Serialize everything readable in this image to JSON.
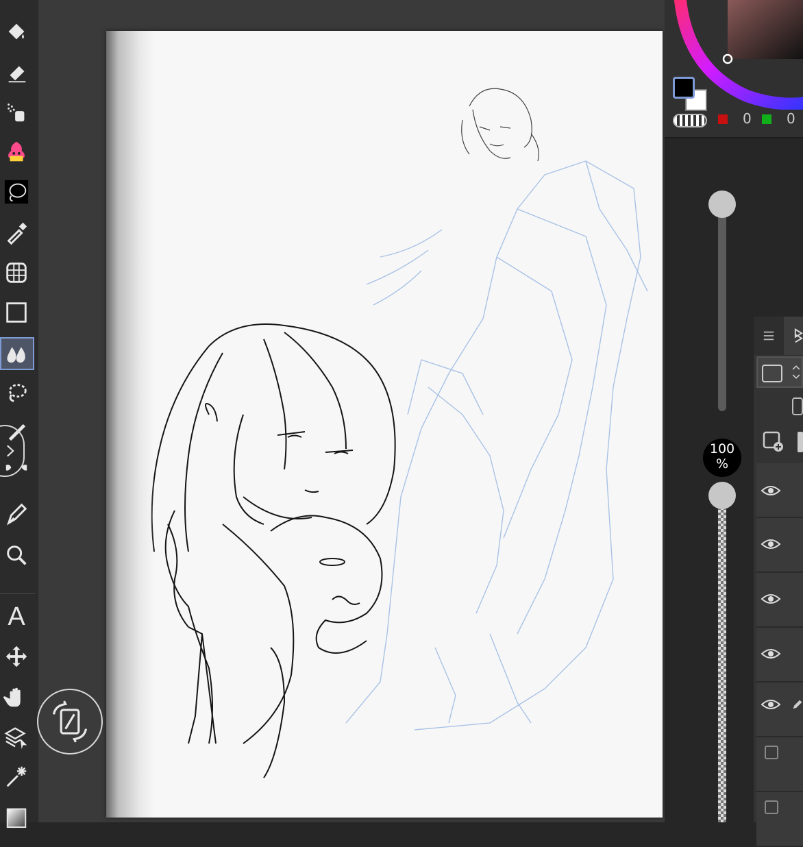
{
  "toolbar": {
    "tools": [
      "fill-icon",
      "eraser-icon",
      "airbrush-icon",
      "decoration-icon",
      "lasso-fill-icon",
      "eyedropper-icon",
      "perspective-icon",
      "rectangle-select-icon",
      "blend-icon",
      "lasso-select-icon",
      "pen-icon",
      "brush-icon",
      "pen-nib-icon",
      "zoom-icon",
      "text-icon",
      "move-icon",
      "hand-icon",
      "layer-move-icon",
      "magic-wand-icon",
      "gradient-icon"
    ],
    "active_tool": "blend-icon",
    "text_tool_label": "A"
  },
  "color": {
    "main": "#000000",
    "sub": "#ffffff",
    "r_value": "0",
    "g_value": "0",
    "accent": "#7f9bd6"
  },
  "brush": {
    "opacity_label": "100\n%",
    "opacity_text": "100",
    "opacity_unit": "%",
    "size_level": 0.38,
    "opacity_level": 1.0
  },
  "layers": {
    "visible": [
      true,
      true,
      true,
      true,
      true,
      false,
      false
    ]
  }
}
